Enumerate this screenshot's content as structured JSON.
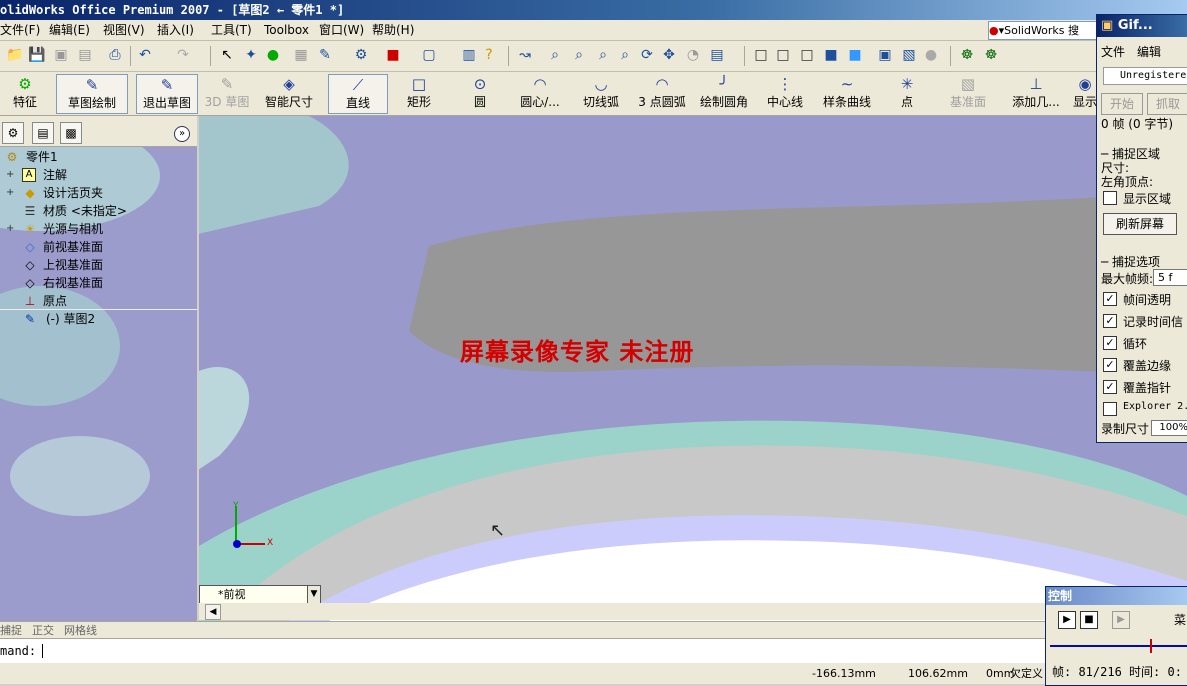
{
  "window": {
    "title": "olidWorks Office Premium 2007 - [草图2 ← 零件1 *]"
  },
  "menu": [
    "文件(F)",
    "编辑(E)",
    "视图(V)",
    "插入(I)",
    "工具(T)",
    "Toolbox",
    "窗口(W)",
    "帮助(H)"
  ],
  "search_box": {
    "label": "SolidWorks 搜"
  },
  "sketch_toolbar": {
    "feature_label": "特征",
    "sketch_label": "草图绘制",
    "exit_sketch": "退出草图",
    "sketch3d": "3D 草图",
    "smart_dim": "智能尺寸",
    "line": "直线",
    "rect": "矩形",
    "circle": "圆",
    "center_arc": "圆心/...",
    "tangent_arc": "切线弧",
    "three_point_arc": "3 点圆弧",
    "fillet": "绘制圆角",
    "centerline": "中心线",
    "spline": "样条曲线",
    "point": "点",
    "plane": "基准面",
    "add_relation": "添加几...",
    "display": "显示"
  },
  "feature_tree": {
    "items": [
      {
        "label": "零件1",
        "icon": "part-icon"
      },
      {
        "label": "注解",
        "icon": "annotation-icon"
      },
      {
        "label": "设计活页夹",
        "icon": "binder-icon"
      },
      {
        "label": "材质 <未指定>",
        "icon": "material-icon"
      },
      {
        "label": "光源与相机",
        "icon": "lights-icon"
      },
      {
        "label": "前视基准面",
        "icon": "plane-icon"
      },
      {
        "label": "上视基准面",
        "icon": "plane-icon"
      },
      {
        "label": "右视基准面",
        "icon": "plane-icon"
      },
      {
        "label": "原点",
        "icon": "origin-icon"
      },
      {
        "label": "(-) 草图2",
        "icon": "sketch-icon"
      }
    ]
  },
  "viewport": {
    "watermark": "屏幕录像专家 未注册",
    "view_name": "*前视",
    "axis_x": "X",
    "axis_y": "Y"
  },
  "status_toggles": [
    "捕捉",
    "正交",
    "网格线"
  ],
  "command": {
    "prompt": "mand:"
  },
  "status_coords": {
    "x": "-166.13mm",
    "y": "106.62mm",
    "z": "0mm",
    "state": "欠定义"
  },
  "gif_panel": {
    "title": "Gif...",
    "menu_file": "文件",
    "menu_edit": "编辑",
    "registration": "Unregistere",
    "start": "开始",
    "capture": "抓取",
    "frames": "0 帧 (0 字节)",
    "capture_area": "捕捉区域",
    "size": "尺寸:",
    "corner": "左角顶点:",
    "show_area": "显示区域",
    "refresh": "刷新屏幕",
    "capture_options": "捕捉选项",
    "max_fps_label": "最大帧频:",
    "max_fps_value": "5 f",
    "opt_transparent": "帧间透明",
    "opt_time": "记录时间信",
    "opt_loop": "循环",
    "opt_edge": "覆盖边缘",
    "opt_pointer": "覆盖指针",
    "opt_explorer": "Explorer 2.",
    "record_size_label": "录制尺寸",
    "record_size_value": "100%"
  },
  "control_panel": {
    "title": "控制",
    "menu": "菜",
    "frame_info": "帧: 81/216 时间: 0:"
  },
  "colors": {
    "title_bar": "#0a246a",
    "viewport": "#9999cc",
    "watermark": "#d40000"
  }
}
